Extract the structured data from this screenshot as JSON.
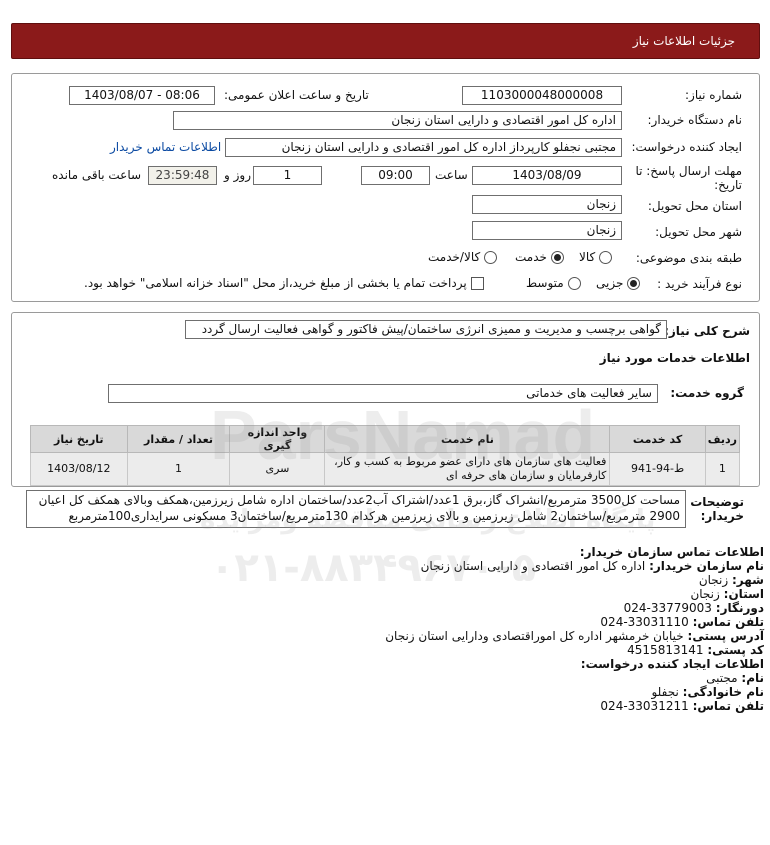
{
  "header": {
    "title": "جزئیات اطلاعات نیاز"
  },
  "labels": {
    "need_number": "شماره نیاز:",
    "announce_datetime": "تاریخ و ساعت اعلان عمومی:",
    "buyer_org": "نام دستگاه خریدار:",
    "requester": "ایجاد کننده درخواست:",
    "deadline_l1": "مهلت ارسال پاسخ: تا",
    "deadline_l2": "تاریخ:",
    "hour": "ساعت",
    "day_and": "روز و",
    "remaining": "ساعت باقی مانده",
    "delivery_province": "استان محل تحویل:",
    "delivery_city": "شهر محل تحویل:",
    "category": "طبقه بندی موضوعی:",
    "purchase_type": "نوع فرآیند خرید :",
    "general_desc": "شرح کلی نیاز:",
    "services_info": "اطلاعات خدمات مورد نیاز",
    "service_group": "گروه خدمت:",
    "buyer_notes_l1": "توضیحات",
    "buyer_notes_l2": "خریدار:"
  },
  "values": {
    "need_number": "1103000048000008",
    "announce_datetime": "1403/08/07 - 08:06",
    "buyer_org": "اداره کل امور اقتصادی و دارایی استان زنجان",
    "requester": "مجتبی نجفلو کارپرداز اداره کل امور اقتصادی و دارایی استان زنجان",
    "contact_link": "اطلاعات تماس خریدار",
    "deadline_date": "1403/08/09",
    "deadline_hour": "09:00",
    "days": "1",
    "time_left": "23:59:48",
    "province": "زنجان",
    "city": "زنجان",
    "general_desc": "گواهی برچسب و مدیریت و ممیزی انرژی ساختمان/پیش فاکتور و گواهی فعالیت ارسال گردد",
    "service_group": "سایر فعالیت های خدماتی",
    "buyer_notes": "مساحت کل3500 مترمربع/انشراک گاز،برق 1عدد/اشتراک آب2عدد/ساختمان اداره شامل زیرزمین،همکف وبالای همکف کل اعیان 2900 مترمربع/ساختمان2 شامل زیرزمین و بالای زیرزمین هرکدام 130مترمربع/ساختمان3 مسکونی سرایداری100مترمربع"
  },
  "category_options": [
    {
      "label": "کالا",
      "selected": false
    },
    {
      "label": "خدمت",
      "selected": true
    },
    {
      "label": "کالا/خدمت",
      "selected": false
    }
  ],
  "purchase_options": [
    {
      "label": "جزیی",
      "selected": true
    },
    {
      "label": "متوسط",
      "selected": false
    }
  ],
  "treasury_note": "پرداخت تمام یا بخشی از مبلغ خرید،از محل \"اسناد خزانه اسلامی\" خواهد بود.",
  "table": {
    "headers": [
      "ردیف",
      "کد خدمت",
      "نام خدمت",
      "واحد اندازه گیری",
      "تعداد / مقدار",
      "تاریخ نیاز"
    ],
    "rows": [
      [
        "1",
        "ط-94-941",
        "فعالیت های سازمان های دارای عضو مربوط به کسب و کار، کارفرمایان و سازمان های حرفه ای",
        "سری",
        "1",
        "1403/08/12"
      ]
    ]
  },
  "contact": {
    "heading": "اطلاعات تماس سازمان خریدار:",
    "org_label": "نام سازمان خریدار:",
    "org": "اداره کل امور اقتصادی و دارایی استان زنجان",
    "city_label": "شهر:",
    "city": "زنجان",
    "province_label": "استان:",
    "province": "زنجان",
    "fax_label": "دورنگار:",
    "fax": "024-33779003",
    "phone_label": "تلفن تماس:",
    "phone": "024-33031110",
    "address_label": "آدرس پستی:",
    "address": "خیابان خرمشهر اداره کل اموراقتصادی ودارایی استان زنجان",
    "postal_label": "کد پستی:",
    "postal": "4515813141",
    "creator_heading": "اطلاعات ایجاد کننده درخواست:",
    "fname_label": "نام:",
    "fname": "مجتبی",
    "lname_label": "نام خانوادگی:",
    "lname": "نجفلو",
    "cphone_label": "تلفن تماس:",
    "cphone": "024-33031211"
  },
  "watermark": {
    "brand": "ParsNamad",
    "tagline": "پایگاه اطلاع رسانی مناقصه ومزایده",
    "phone": "۰۲۱-۸۸۳۴۹۶۷۰-۵"
  }
}
